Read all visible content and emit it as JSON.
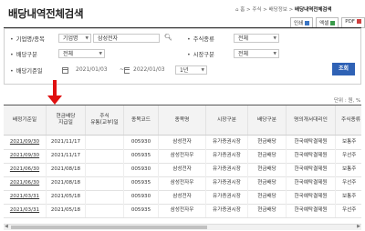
{
  "page": {
    "title": "배당내역전체검색",
    "breadcrumb": [
      "홈",
      "주식",
      "배당정보",
      "배당내역전체검색"
    ],
    "toolbar": {
      "print": "인쇄",
      "excel": "엑셀",
      "pdf": "PDF"
    }
  },
  "form": {
    "company": {
      "label": "기업명/종목",
      "select_value": "기업명",
      "input_value": "삼성전자"
    },
    "stock_type": {
      "label": "주식종류",
      "value": "전체"
    },
    "dividend_type": {
      "label": "배당구분",
      "value": "전체"
    },
    "market_type": {
      "label": "시장구분",
      "value": "전체"
    },
    "base_date": {
      "label": "배당기준일",
      "from": "2021/01/03",
      "to": "2022/01/03",
      "period": "1년"
    },
    "search_label": "조회"
  },
  "unit_text": "단위 : 원, %",
  "table": {
    "headers": [
      "배정기준일",
      "현금배당\n지급일",
      "주식\n유통(교부)일",
      "종목코드",
      "종목명",
      "시장구분",
      "배당구분",
      "명의개서대리인",
      "주식종류"
    ],
    "rows": [
      [
        "2021/09/30",
        "2021/11/17",
        "",
        "005930",
        "삼성전자",
        "유가증권시장",
        "현금배당",
        "한국예탁결제원",
        "보통주"
      ],
      [
        "2021/09/30",
        "2021/11/17",
        "",
        "005935",
        "삼성전자우",
        "유가증권시장",
        "현금배당",
        "한국예탁결제원",
        "우선주"
      ],
      [
        "2021/06/30",
        "2021/08/18",
        "",
        "005930",
        "삼성전자",
        "유가증권시장",
        "현금배당",
        "한국예탁결제원",
        "보통주"
      ],
      [
        "2021/06/30",
        "2021/08/18",
        "",
        "005935",
        "삼성전자우",
        "유가증권시장",
        "현금배당",
        "한국예탁결제원",
        "우선주"
      ],
      [
        "2021/03/31",
        "2021/05/18",
        "",
        "005930",
        "삼성전자",
        "유가증권시장",
        "현금배당",
        "한국예탁결제원",
        "보통주"
      ],
      [
        "2021/03/31",
        "2021/05/18",
        "",
        "005935",
        "삼성전자우",
        "유가증권시장",
        "현금배당",
        "한국예탁결제원",
        "우선주"
      ]
    ]
  },
  "colors": {
    "accent": "#2f62b5",
    "annotation_arrow": "#e01010"
  }
}
